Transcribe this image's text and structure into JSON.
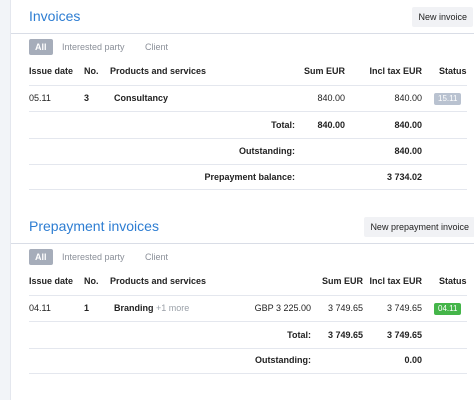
{
  "invoices": {
    "title": "Invoices",
    "new_button": "New invoice",
    "filters": [
      "All",
      "Interested party",
      "Client"
    ],
    "columns": [
      "Issue date",
      "No.",
      "Products and services",
      "Sum EUR",
      "Incl tax EUR",
      "Status"
    ],
    "rows": [
      {
        "date": "05.11",
        "no": "3",
        "product": "Consultancy",
        "sum": "840.00",
        "incl_tax": "840.00",
        "status": "15.11",
        "status_color": "#b9c2d0"
      }
    ],
    "total_label": "Total:",
    "total_sum": "840.00",
    "total_incl": "840.00",
    "outstanding_label": "Outstanding:",
    "outstanding_value": "840.00",
    "prepayment_label": "Prepayment balance:",
    "prepayment_value": "3 734.02"
  },
  "prepayment_invoices": {
    "title": "Prepayment invoices",
    "new_button": "New prepayment invoice",
    "filters": [
      "All",
      "Interested party",
      "Client"
    ],
    "columns": [
      "Issue date",
      "No.",
      "Products and services",
      "Sum EUR",
      "Incl tax EUR",
      "Status"
    ],
    "rows": [
      {
        "date": "04.11",
        "no": "1",
        "product": "Branding",
        "more": "+1 more",
        "foreign": "GBP 3 225.00",
        "sum": "3 749.65",
        "incl_tax": "3 749.65",
        "status": "04.11",
        "status_color": "#44b549"
      }
    ],
    "total_label": "Total:",
    "total_sum": "3 749.65",
    "total_incl": "3 749.65",
    "outstanding_label": "Outstanding:",
    "outstanding_value": "0.00"
  }
}
